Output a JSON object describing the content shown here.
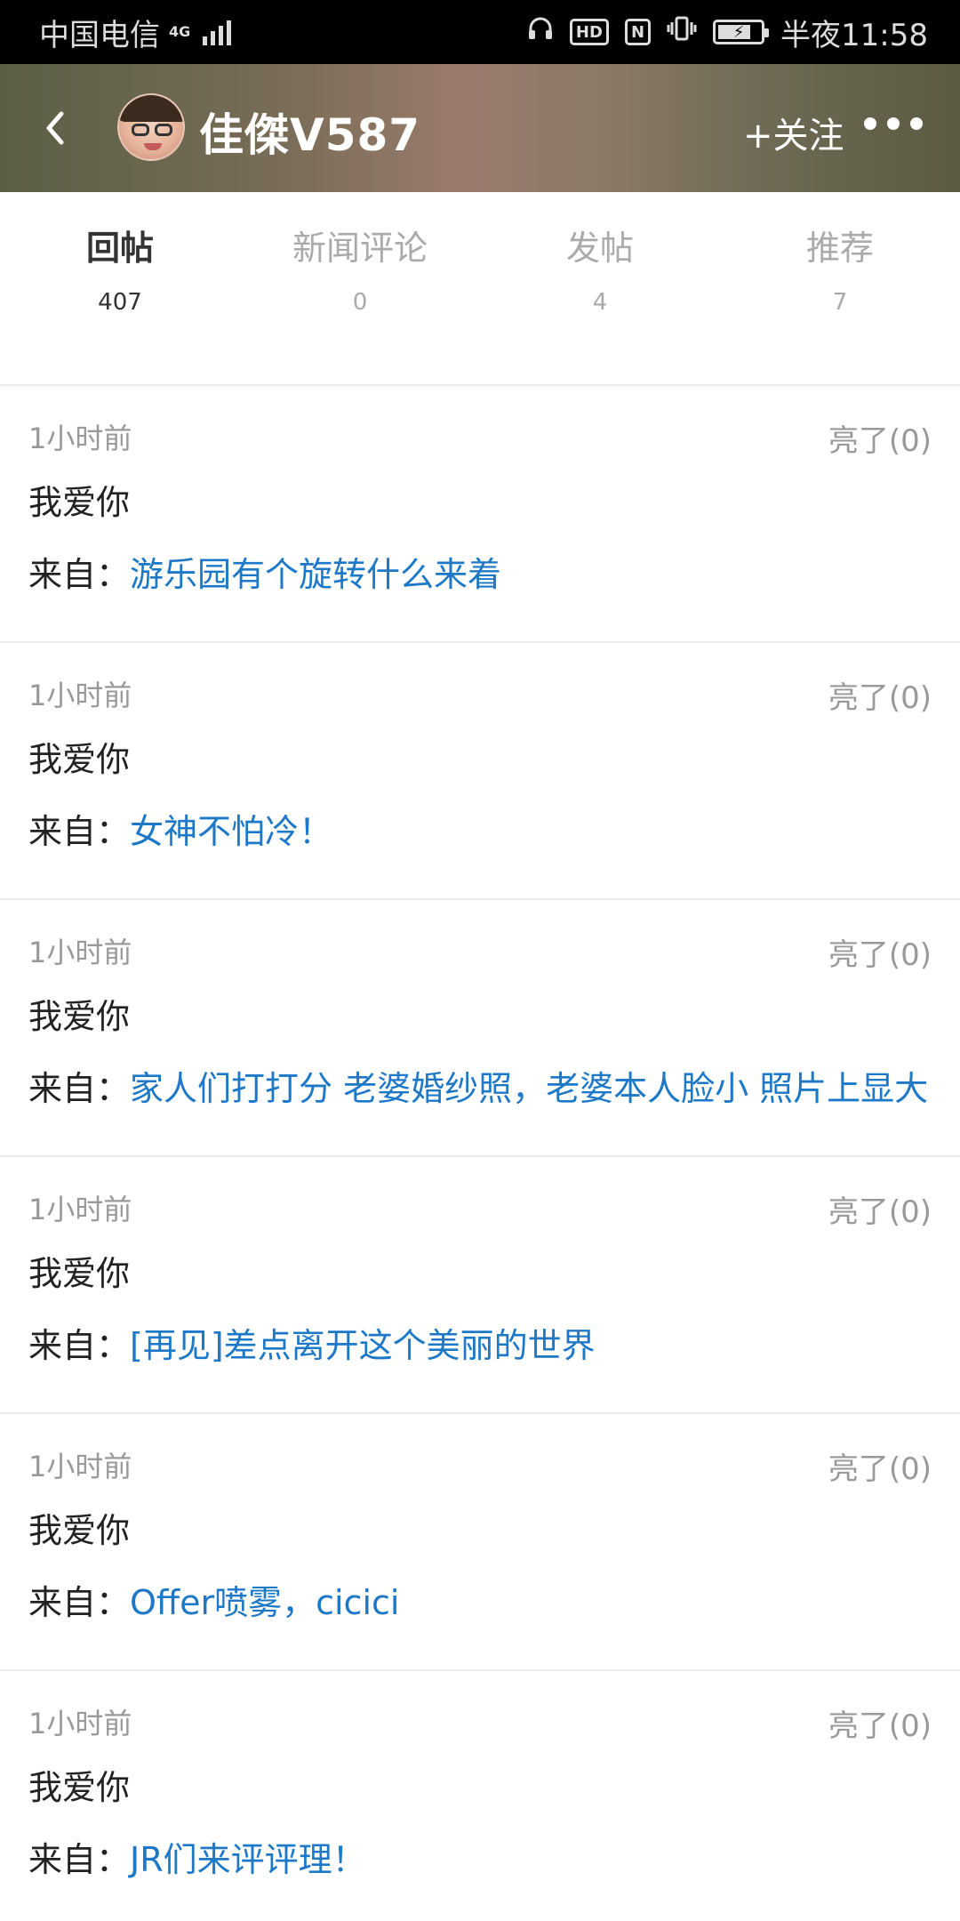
{
  "status_bar": {
    "carrier": "中国电信",
    "network": "4G",
    "hd": "HD",
    "nfc": "N",
    "time": "半夜11:58"
  },
  "header": {
    "username": "佳傑V587",
    "follow_label": "+关注",
    "colors": {
      "background": "#7a6d57",
      "text": "#ffffff"
    }
  },
  "tabs": [
    {
      "label": "回帖",
      "count": "407",
      "active": true
    },
    {
      "label": "新闻评论",
      "count": "0",
      "active": false
    },
    {
      "label": "发帖",
      "count": "4",
      "active": false
    },
    {
      "label": "推荐",
      "count": "7",
      "active": false
    }
  ],
  "from_prefix": "来自：",
  "posts": [
    {
      "time": "1小时前",
      "liked": "亮了(0)",
      "content": "我爱你",
      "source": "游乐园有个旋转什么来着"
    },
    {
      "time": "1小时前",
      "liked": "亮了(0)",
      "content": "我爱你",
      "source": "女神不怕冷！"
    },
    {
      "time": "1小时前",
      "liked": "亮了(0)",
      "content": "我爱你",
      "source": "家人们打打分 老婆婚纱照，老婆本人脸小 照片上显大"
    },
    {
      "time": "1小时前",
      "liked": "亮了(0)",
      "content": "我爱你",
      "source": "[再见]差点离开这个美丽的世界"
    },
    {
      "time": "1小时前",
      "liked": "亮了(0)",
      "content": "我爱你",
      "source": "Offer喷雾，cicici"
    },
    {
      "time": "1小时前",
      "liked": "亮了(0)",
      "content": "我爱你",
      "source": "JR们来评评理！"
    }
  ],
  "colors": {
    "link": "#1e78c8",
    "muted": "#999999",
    "divider": "#ebebeb"
  }
}
